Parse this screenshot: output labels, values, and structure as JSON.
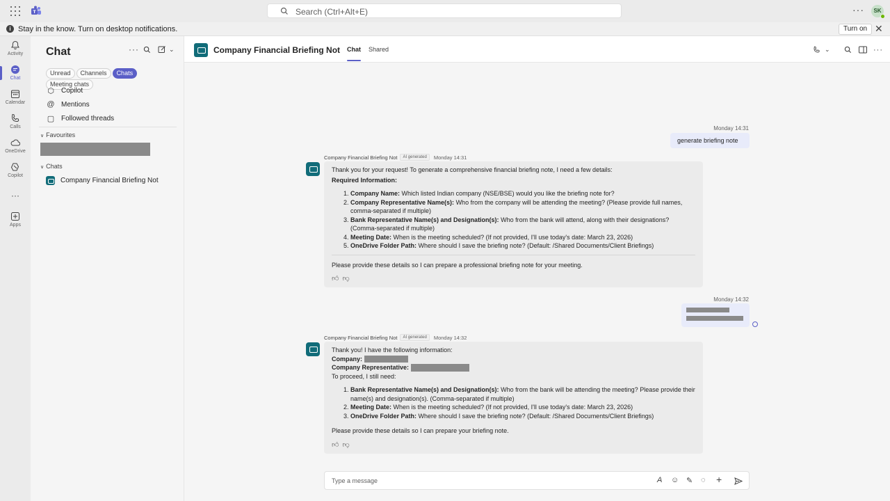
{
  "topbar": {
    "search_placeholder": "Search (Ctrl+Alt+E)",
    "more": "···",
    "avatar_initials": "SK"
  },
  "notification": {
    "text": "Stay in the know. Turn on desktop notifications.",
    "button": "Turn on",
    "close": "✕"
  },
  "rail": {
    "items": [
      {
        "label": "Activity",
        "icon": "bell-icon"
      },
      {
        "label": "Chat",
        "icon": "chat-icon"
      },
      {
        "label": "Calendar",
        "icon": "calendar-icon"
      },
      {
        "label": "Calls",
        "icon": "phone-icon"
      },
      {
        "label": "OneDrive",
        "icon": "cloud-icon"
      },
      {
        "label": "Copilot",
        "icon": "copilot-icon"
      },
      {
        "label": "Apps",
        "icon": "apps-plus-icon"
      }
    ],
    "more": "···"
  },
  "chatlist": {
    "title": "Chat",
    "filters": [
      "Unread",
      "Channels",
      "Chats",
      "Meeting chats"
    ],
    "active_filter": "Chats",
    "quick_links": [
      "Copilot",
      "Mentions",
      "Followed threads"
    ],
    "sections": {
      "favourites": "Favourites",
      "chats": "Chats"
    },
    "chat_items": [
      "Company Financial Briefing Not"
    ]
  },
  "header": {
    "title": "Company Financial Briefing Not",
    "tabs": [
      "Chat",
      "Shared"
    ],
    "active_tab": "Chat"
  },
  "messages": {
    "user1": {
      "time": "Monday 14:31",
      "text": "generate briefing note"
    },
    "bot1": {
      "sender": "Company Financial Briefing Not",
      "ai_label": "AI generated",
      "time": "Monday 14:31",
      "intro": "Thank you for your request! To generate a comprehensive financial briefing note, I need a few details:",
      "heading": "Required Information:",
      "items": [
        {
          "label": "Company Name:",
          "text": "Which listed Indian company (NSE/BSE) would you like the briefing note for?"
        },
        {
          "label": "Company Representative Name(s):",
          "text": "Who from the company will be attending the meeting? (Please provide full names, comma-separated if multiple)"
        },
        {
          "label": "Bank Representative Name(s) and Designation(s):",
          "text": "Who from the bank will attend, along with their designations? (Comma-separated if multiple)"
        },
        {
          "label": "Meeting Date:",
          "text": "When is the meeting scheduled? (If not provided, I'll use today's date: March 23, 2026)"
        },
        {
          "label": "OneDrive Folder Path:",
          "text": "Where should I save the briefing note? (Default: /Shared Documents/Client Briefings)"
        }
      ],
      "closing": "Please provide these details so I can prepare a professional briefing note for your meeting."
    },
    "user2": {
      "time": "Monday 14:32"
    },
    "bot2": {
      "sender": "Company Financial Briefing Not",
      "ai_label": "AI generated",
      "time": "Monday 14:32",
      "intro": "Thank you! I have the following information:",
      "company_label": "Company:",
      "rep_label": "Company Representative:",
      "proceed": "To proceed, I still need:",
      "items": [
        {
          "label": "Bank Representative Name(s) and Designation(s):",
          "text": "Who from the bank will be attending the meeting? Please provide their name(s) and designation(s). (Comma-separated if multiple)"
        },
        {
          "label": "Meeting Date:",
          "text": "When is the meeting scheduled? (If not provided, I'll use today's date: March 23, 2026)"
        },
        {
          "label": "OneDrive Folder Path:",
          "text": "Where should I save the briefing note? (Default: /Shared Documents/Client Briefings)"
        }
      ],
      "closing": "Please provide these details so I can prepare your briefing note."
    }
  },
  "composer": {
    "placeholder": "Type a message"
  },
  "colors": {
    "accent": "#5b5fc7",
    "bot": "#116c79"
  }
}
